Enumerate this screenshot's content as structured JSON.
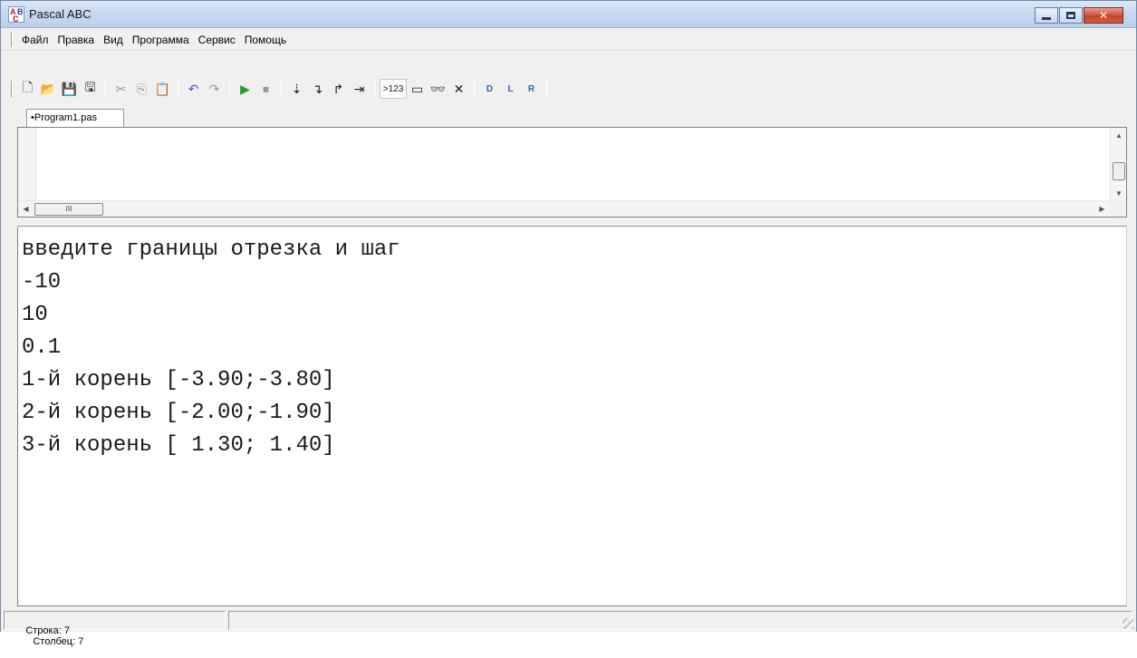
{
  "window": {
    "title": "Pascal ABC"
  },
  "menu": {
    "items": [
      "Файл",
      "Правка",
      "Вид",
      "Программа",
      "Сервис",
      "Помощь"
    ]
  },
  "toolbar": {
    "buttons": [
      {
        "icon": "new-file-icon",
        "glyph": "🗋"
      },
      {
        "icon": "open-folder-icon",
        "glyph": "📂"
      },
      {
        "icon": "save-icon",
        "glyph": "💾"
      },
      {
        "icon": "save-all-icon",
        "glyph": "🖫"
      },
      {
        "icon": "cut-icon",
        "glyph": "✂"
      },
      {
        "icon": "copy-icon",
        "glyph": "⎘"
      },
      {
        "icon": "paste-icon",
        "glyph": "📋"
      },
      {
        "icon": "undo-icon",
        "glyph": "↶"
      },
      {
        "icon": "redo-icon",
        "glyph": "↷"
      },
      {
        "icon": "run-icon",
        "glyph": "▶"
      },
      {
        "icon": "stop-icon",
        "glyph": "⏹"
      },
      {
        "icon": "step-into-icon",
        "glyph": "⇣"
      },
      {
        "icon": "step-over-icon",
        "glyph": "↴"
      },
      {
        "icon": "step-out-icon",
        "glyph": "↱"
      },
      {
        "icon": "run-to-cursor-icon",
        "glyph": "⇥"
      },
      {
        "icon": "output-format-icon",
        "label": ">123"
      },
      {
        "icon": "window-icon",
        "glyph": "▭"
      },
      {
        "icon": "watch-icon",
        "glyph": "👓"
      },
      {
        "icon": "delete-icon",
        "glyph": "✕"
      },
      {
        "icon": "doc-d-icon",
        "glyph": "D"
      },
      {
        "icon": "doc-l-icon",
        "glyph": "L"
      },
      {
        "icon": "doc-r-icon",
        "glyph": "R"
      }
    ]
  },
  "tabs": [
    {
      "label": "•Program1.pas"
    }
  ],
  "editor": {
    "hscroll_thumb_label": "III"
  },
  "output": {
    "lines": [
      "введите границы отрезка и шаг",
      "-10",
      "10",
      "0.1",
      "1-й корень [-3.90;-3.80]",
      "2-й корень [-2.00;-1.90]",
      "3-й корень [ 1.30; 1.40]"
    ]
  },
  "status": {
    "row_label": "Строка: 7",
    "col_label": "Столбец: 7"
  },
  "colors": {
    "run_green": "#2a9d2a",
    "stop_red": "#b22222",
    "close_red": "#c9452c"
  }
}
